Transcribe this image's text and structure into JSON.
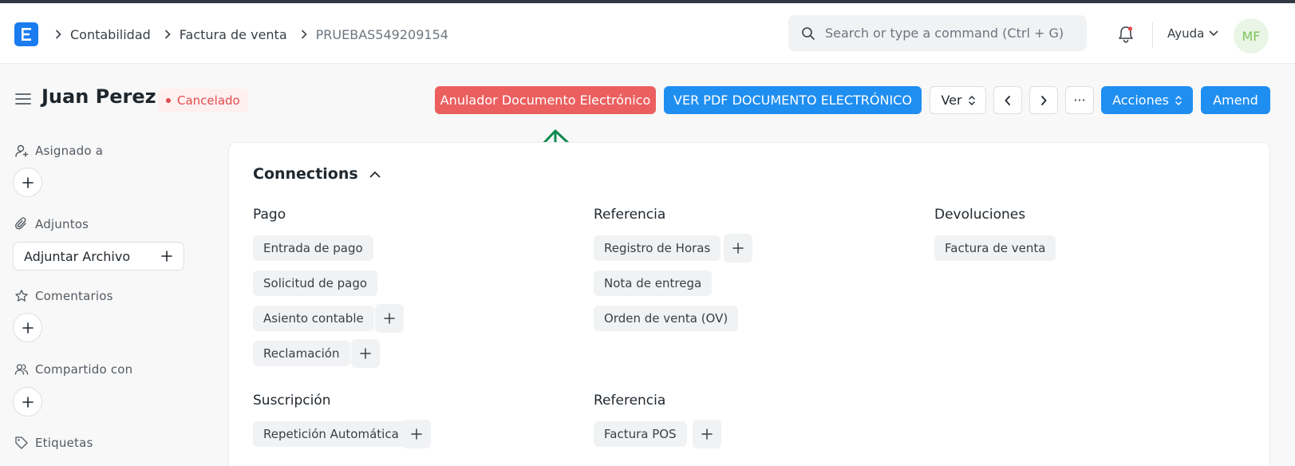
{
  "breadcrumbs": [
    {
      "label": "Contabilidad"
    },
    {
      "label": "Factura de venta"
    },
    {
      "label": "PRUEBAS549209154"
    }
  ],
  "search": {
    "placeholder": "Search or type a command (Ctrl + G)"
  },
  "navbar": {
    "help_label": "Ayuda",
    "avatar_initials": "MF"
  },
  "page": {
    "title": "Juan Perez",
    "status": "Cancelado",
    "actions": {
      "annul": "Anulador Documento Electrónico",
      "pdf": "VER PDF DOCUMENTO ELECTRÓNICO",
      "view": "Ver",
      "more": "···",
      "actions": "Acciones",
      "amend": "Amend"
    }
  },
  "sidebar": {
    "assigned": "Asignado a",
    "attachments": "Adjuntos",
    "attach_button": "Adjuntar Archivo",
    "comments": "Comentarios",
    "shared": "Compartido con",
    "tags": "Etiquetas"
  },
  "connections": {
    "title": "Connections",
    "groups": [
      {
        "title": "Pago",
        "items": [
          "Entrada de pago",
          "Solicitud de pago",
          "Asiento contable",
          "Reclamación"
        ]
      },
      {
        "title": "Referencia",
        "items": [
          "Registro de Horas",
          "Nota de entrega",
          "Orden de venta (OV)"
        ]
      },
      {
        "title": "Devoluciones",
        "items": [
          "Factura de venta"
        ]
      },
      {
        "title": "Suscripción",
        "items": [
          "Repetición Automática"
        ]
      },
      {
        "title": "Referencia",
        "items": [
          "Factura POS"
        ]
      }
    ]
  },
  "colors": {
    "primary": "#1f8ef1",
    "danger": "#ec5f5f",
    "status_cancelled": "#e24c4c",
    "annotation_arrow": "#0e8a4e"
  }
}
